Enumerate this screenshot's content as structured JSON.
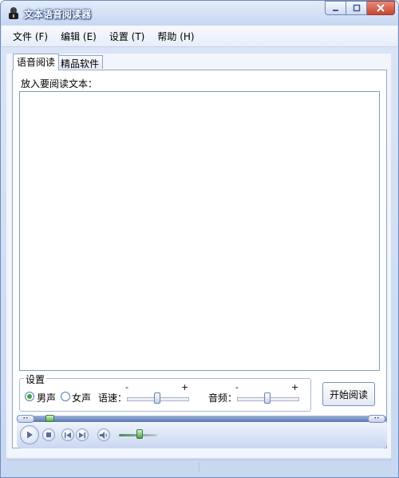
{
  "window": {
    "title": "文本语音阅读器"
  },
  "menu": [
    {
      "label": "文件 (F)"
    },
    {
      "label": "编辑 (E)"
    },
    {
      "label": "设置 (T)"
    },
    {
      "label": "帮助 (H)"
    }
  ],
  "tabs": [
    {
      "label": "语音阅读"
    },
    {
      "label": "精品软件"
    }
  ],
  "reader": {
    "prompt": "放入要阅读文本：",
    "text": ""
  },
  "settings": {
    "group_title": "设置",
    "voice_options": [
      {
        "label": "男声",
        "selected": true
      },
      {
        "label": "女声",
        "selected": false
      }
    ],
    "speed_label": "语速：",
    "speed_level": 0.5,
    "pitch_label": "音频：",
    "pitch_level": 0.5,
    "minus": "-",
    "plus": "+"
  },
  "start_button": "开始阅读",
  "player": {
    "seek_position": 0.03,
    "volume_level": 0.5
  },
  "colors": {
    "accent": "#5a78b4",
    "window_frame": "#c8d8f1",
    "radio_selected": "#3ea83e"
  }
}
